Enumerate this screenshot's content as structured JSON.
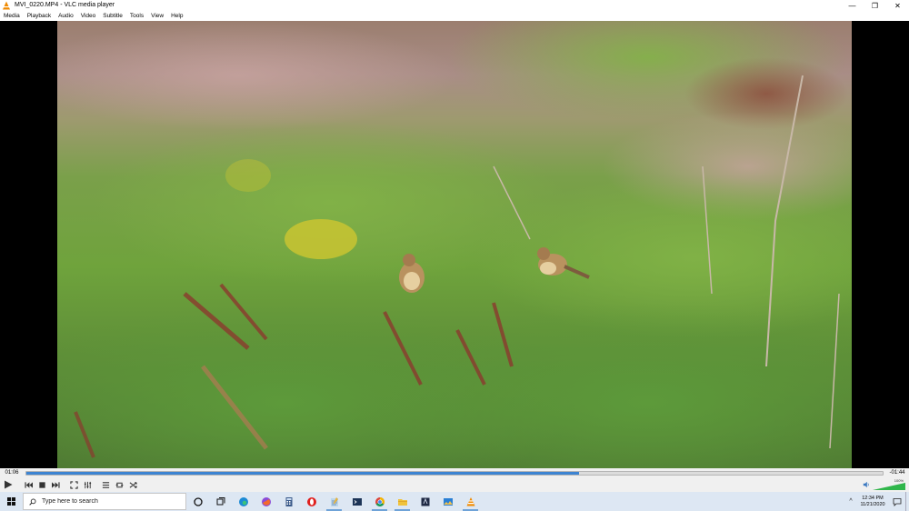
{
  "window": {
    "title": "MVI_0220.MP4 - VLC media player",
    "minimize_glyph": "—",
    "restore_glyph": "❐",
    "close_glyph": "✕"
  },
  "menu": {
    "items": [
      "Media",
      "Playback",
      "Audio",
      "Video",
      "Subtitle",
      "Tools",
      "View",
      "Help"
    ]
  },
  "player": {
    "elapsed": "01:06",
    "remaining": "-01:44",
    "progress": 0.645,
    "volume_percent": "100%",
    "volume_level": 1.0,
    "accent_color": "#3d84d2",
    "volume_color": "#2fb64a"
  },
  "controls": {
    "buttons": [
      "play-icon",
      "previous-icon",
      "stop-icon",
      "next-icon",
      "fullscreen-icon",
      "extended-settings-icon",
      "playlist-icon",
      "loop-icon",
      "shuffle-icon"
    ]
  },
  "taskbar": {
    "search_placeholder": "Type here to search",
    "clock_time": "12:34 PM",
    "clock_date": "11/21/2020",
    "tray_chevron": "^",
    "apps": [
      "cortana-icon",
      "task-view-icon",
      "edge-icon",
      "firefox-icon",
      "calculator-icon",
      "opera-icon",
      "notepad-icon",
      "terminal-icon",
      "chrome-icon",
      "file-explorer-icon",
      "app-icon",
      "photos-icon",
      "vlc-icon"
    ]
  }
}
